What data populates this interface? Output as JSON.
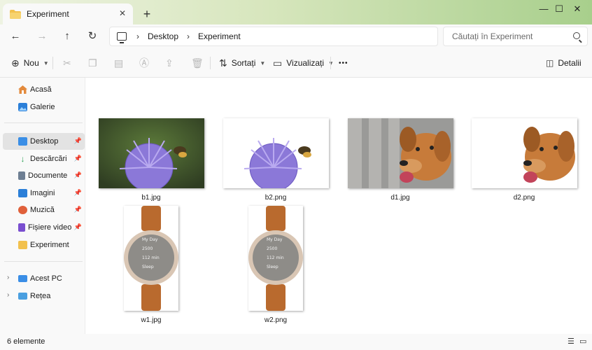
{
  "window": {
    "tab_title": "Experiment",
    "new_tab": "+",
    "controls": {
      "minimize": "—",
      "maximize": "☐",
      "close": "✕"
    }
  },
  "nav": {
    "back": "←",
    "forward": "→",
    "up": "↑",
    "refresh": "↻",
    "breadcrumb": [
      "Desktop",
      "Experiment"
    ],
    "search_placeholder": "Căutați în Experiment"
  },
  "commands": {
    "new_label": "Nou",
    "sort_label": "Sortați",
    "view_label": "Vizualizați",
    "more": "•••",
    "details_label": "Detalii"
  },
  "sidebar": {
    "home": "Acasă",
    "gallery": "Galerie",
    "pinned": [
      {
        "label": "Desktop",
        "icon": "desktop-icon",
        "color": "#3a8ee6",
        "pinned": true,
        "selected": true
      },
      {
        "label": "Descărcări",
        "icon": "download-icon",
        "color": "#2aa053",
        "pinned": true
      },
      {
        "label": "Documente",
        "icon": "documents-icon",
        "color": "#6e7f93",
        "pinned": true
      },
      {
        "label": "Imagini",
        "icon": "pictures-icon",
        "color": "#2b7fd8",
        "pinned": true
      },
      {
        "label": "Muzică",
        "icon": "music-icon",
        "color": "#e0603a",
        "pinned": true
      },
      {
        "label": "Fișiere video",
        "icon": "videos-icon",
        "color": "#7a4fd0",
        "pinned": true
      },
      {
        "label": "Experiment",
        "icon": "folder-icon",
        "color": "#f2c14e",
        "pinned": false
      }
    ],
    "this_pc": "Acest PC",
    "network": "Rețea"
  },
  "files": [
    {
      "name": "b1.jpg",
      "kind": "bee-photo"
    },
    {
      "name": "b2.png",
      "kind": "bee-cutout"
    },
    {
      "name": "d1.jpg",
      "kind": "dog-photo"
    },
    {
      "name": "d2.png",
      "kind": "dog-cutout"
    },
    {
      "name": "w1.jpg",
      "kind": "watch"
    },
    {
      "name": "w2.png",
      "kind": "watch"
    }
  ],
  "watch_face": {
    "title": "My Day",
    "steps": "2500",
    "minutes": "112 min",
    "sleep": "Sleep"
  },
  "status": {
    "count": "6 elemente"
  },
  "colors": {
    "accent": "#0067c0",
    "folder": "#f2c14e",
    "flower": "#8b78d8",
    "dog": "#c77b3a",
    "strap": "#b96a2e"
  }
}
